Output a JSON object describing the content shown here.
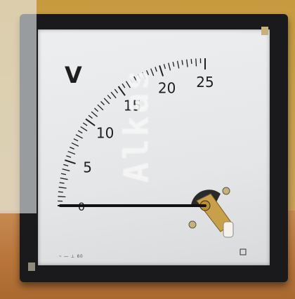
{
  "photo": {
    "subject": "panel voltmeter"
  },
  "meter": {
    "unit_symbol": "V",
    "scale_labels": [
      "0",
      "5",
      "10",
      "15",
      "20",
      "25"
    ],
    "scale_max": 25,
    "needle_value": 0,
    "fine_print": "~ — ⊥ 60"
  },
  "watermark": {
    "text": "Alkas"
  },
  "colors": {
    "meter_body": "#1a1a1c",
    "meter_face": "#e6e8ea",
    "needle": "#111111",
    "background_wall": "#c79a3e",
    "table": "#b9773e"
  }
}
